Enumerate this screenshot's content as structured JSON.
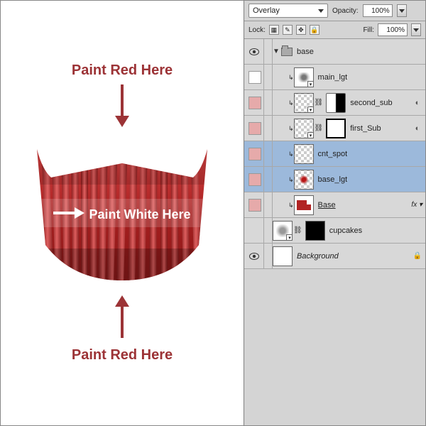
{
  "canvas": {
    "label_top": "Paint Red Here",
    "label_center": "Paint White Here",
    "label_bottom": "Paint Red Here"
  },
  "panel": {
    "blend_mode": "Overlay",
    "opacity_label": "Opacity:",
    "opacity_value": "100%",
    "lock_label": "Lock:",
    "fill_label": "Fill:",
    "fill_value": "100%"
  },
  "layers": [
    {
      "id": "grp",
      "name": "base",
      "type": "group",
      "visible": true,
      "selected": false,
      "indent": 0
    },
    {
      "id": "main_lgt",
      "name": "main_lgt",
      "type": "layer",
      "visible": false,
      "selected": false,
      "indent": 1,
      "thumb": "eye",
      "smart": true,
      "reveal": null
    },
    {
      "id": "second_sub",
      "name": "second_sub",
      "type": "layer",
      "visible": true,
      "selected": false,
      "indent": 1,
      "thumb": "checker",
      "smart": true,
      "mask": "half",
      "reveal": "right"
    },
    {
      "id": "first_sub",
      "name": "first_Sub",
      "type": "layer",
      "visible": true,
      "selected": false,
      "indent": 1,
      "thumb": "checker",
      "smart": true,
      "mask": "white",
      "reveal": "right"
    },
    {
      "id": "cnt_spot",
      "name": "cnt_spot",
      "type": "layer",
      "visible": true,
      "selected": true,
      "indent": 1,
      "thumb": "checker"
    },
    {
      "id": "base_lgt",
      "name": "base_lgt",
      "type": "layer",
      "visible": true,
      "selected": true,
      "indent": 1,
      "thumb": "blob"
    },
    {
      "id": "base",
      "name": "Base",
      "type": "shape",
      "visible": true,
      "selected": false,
      "indent": 1,
      "thumb": "base",
      "underline": true,
      "fx": true
    },
    {
      "id": "cupcakes",
      "name": "cupcakes",
      "type": "layer",
      "visible": false,
      "selected": false,
      "indent": 0,
      "thumb": "blur",
      "smart": true,
      "mask": "black"
    },
    {
      "id": "bg",
      "name": "Background",
      "type": "bg",
      "visible": true,
      "selected": false,
      "indent": 0,
      "thumb": "white",
      "italic": true,
      "locked": true
    }
  ]
}
